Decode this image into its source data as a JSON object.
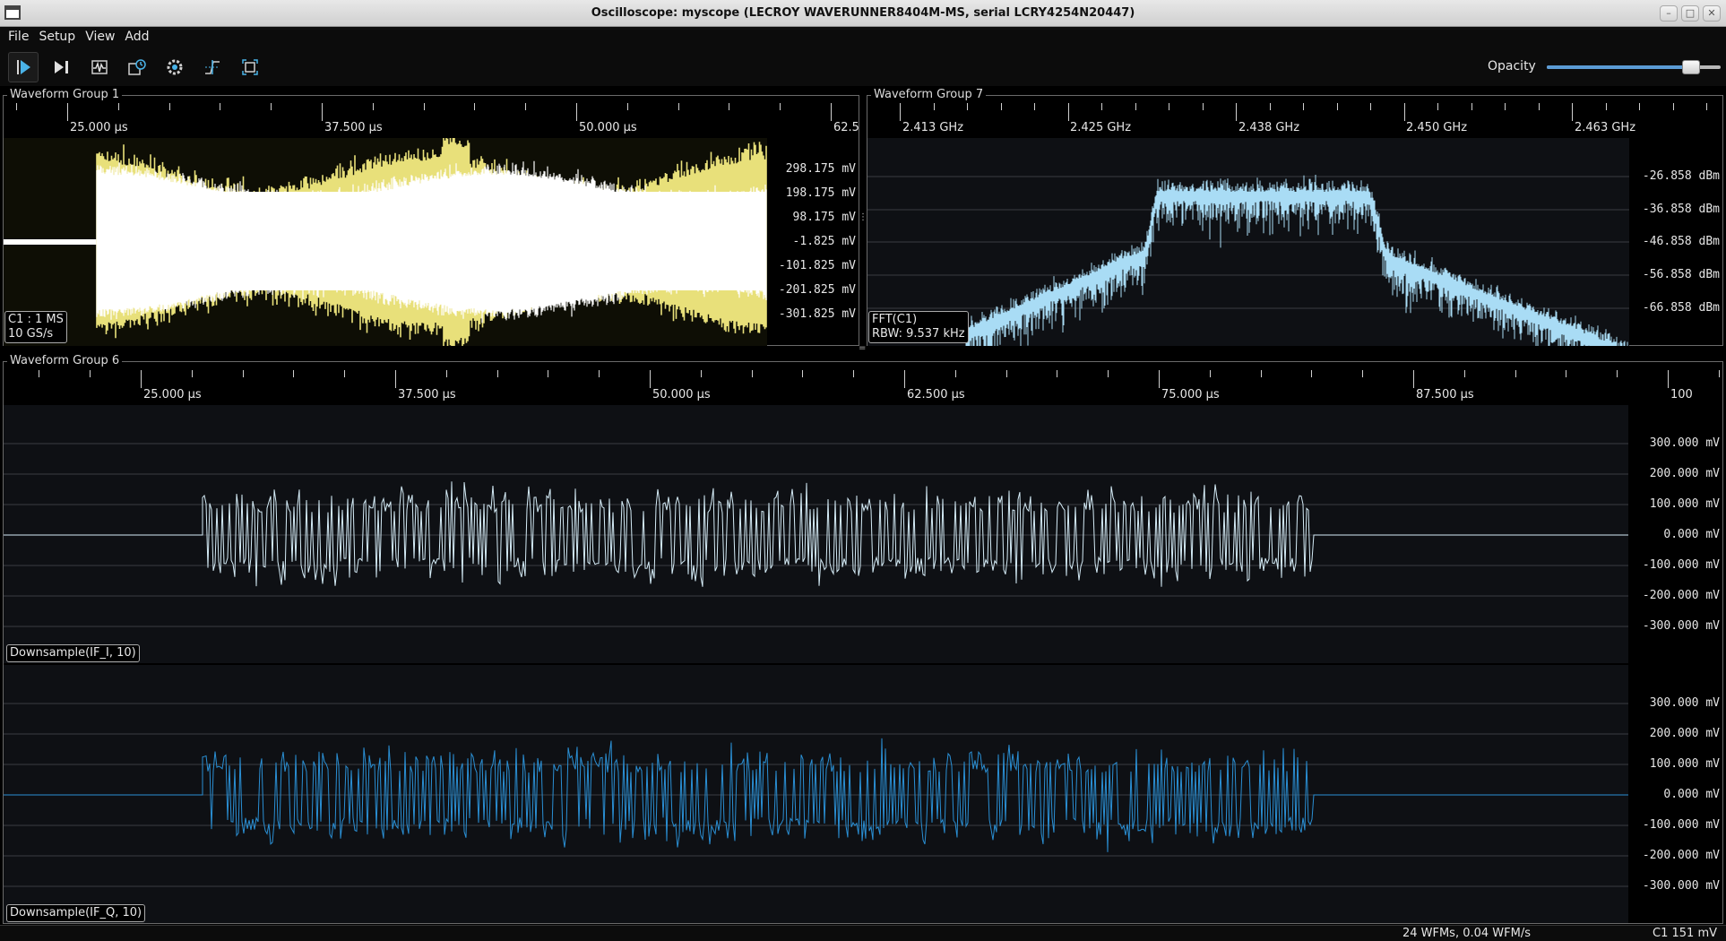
{
  "window": {
    "title": "Oscilloscope: myscope (LECROY WAVERUNNER8404M-MS, serial LCRY4254N20447)"
  },
  "menu": [
    "File",
    "Setup",
    "View",
    "Add"
  ],
  "toolbar": {
    "buttons": [
      "play-icon",
      "single-trigger-icon",
      "waveform-icon",
      "history-icon",
      "settings-gear-icon",
      "trigger-edge-icon",
      "fullscreen-icon"
    ],
    "opacity_label": "Opacity",
    "opacity_value": 0.83
  },
  "group1": {
    "title": "Waveform Group 1",
    "ticks": [
      "25.000 µs",
      "37.500 µs",
      "50.000 µs",
      "62.5"
    ],
    "y_labels": [
      "298.175  mV",
      "198.175  mV",
      "98.175  mV",
      "-1.825  mV",
      "-101.825  mV",
      "-201.825  mV",
      "-301.825  mV"
    ],
    "channel_line1": "C1 : 1 MS",
    "channel_line2": "10 GS/s",
    "colors": {
      "trace": "#ffffff",
      "plot_bg": "#181708",
      "outline": "#e8e07a"
    }
  },
  "group7": {
    "title": "Waveform Group 7",
    "ticks": [
      "2.413 GHz",
      "2.425 GHz",
      "2.438 GHz",
      "2.450 GHz",
      "2.463 GHz"
    ],
    "y_labels": [
      "-26.858  dBm",
      "-36.858  dBm",
      "-46.858  dBm",
      "-56.858  dBm",
      "-66.858  dBm"
    ],
    "channel_line1": "FFT(C1)",
    "channel_line2": "RBW: 9.537 kHz",
    "colors": {
      "trace": "#a9dcf5",
      "plot_bg": "#0e1014"
    }
  },
  "group6": {
    "title": "Waveform Group 6",
    "ticks": [
      "25.000 µs",
      "37.500 µs",
      "50.000 µs",
      "62.500 µs",
      "75.000 µs",
      "87.500 µs",
      "100"
    ],
    "y_labels": [
      "300.000  mV",
      "200.000  mV",
      "100.000  mV",
      "0.000  mV",
      "-100.000  mV",
      "-200.000  mV",
      "-300.000  mV"
    ],
    "channel_i": "Downsample(IF_I, 10)",
    "channel_q": "Downsample(IF_Q, 10)",
    "colors": {
      "trace_i": "#d5ecf7",
      "trace_q": "#2a8fd4",
      "plot_bg": "#0e1014"
    }
  },
  "status": {
    "left": "24 WFMs, 0.04 WFM/s",
    "right": "C1 151 mV"
  }
}
